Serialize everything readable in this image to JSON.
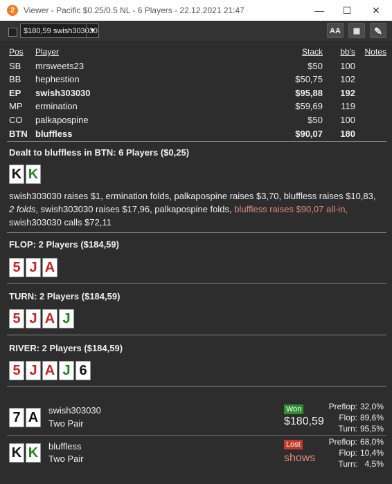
{
  "window": {
    "title": "Viewer - Pacific $0.25/0.5 NL - 6 Players - 22.12.2021 21:47",
    "icon": "2",
    "minimize": "—",
    "maximize": "☐",
    "close": "✕"
  },
  "toolbar": {
    "hand_select": "$180,59 swish303030",
    "arrow": "▼",
    "font_btn": "AA",
    "grid_btn": "▦",
    "edit_btn": "✎"
  },
  "table": {
    "headers": {
      "pos": "Pos",
      "player": "Player",
      "stack": "Stack",
      "bbs": "bb's",
      "notes": "Notes"
    },
    "rows": [
      {
        "pos": "SB",
        "player": "mrsweets23",
        "stack": "$50",
        "bbs": "100"
      },
      {
        "pos": "BB",
        "player": "hephestion",
        "stack": "$50,75",
        "bbs": "102"
      },
      {
        "pos": "EP",
        "player": "swish303030",
        "stack": "$95,88",
        "bbs": "192"
      },
      {
        "pos": "MP",
        "player": "ermination",
        "stack": "$59,69",
        "bbs": "119"
      },
      {
        "pos": "CO",
        "player": "palkapospine",
        "stack": "$50",
        "bbs": "100"
      },
      {
        "pos": "BTN",
        "player": "bluffless",
        "stack": "$90,07",
        "bbs": "180"
      }
    ]
  },
  "preflop": {
    "title": "Dealt to bluffless in BTN: 6 Players ($0,25)",
    "cards": [
      {
        "rank": "K",
        "color": "#111111"
      },
      {
        "rank": "K",
        "color": "#1a8a1a"
      }
    ],
    "actions": {
      "a1": "swish303030 raises $1, ermination folds, palkapospine raises $3,70, bluffless raises $10,83,",
      "a2": "2 folds",
      "a3": ", swish303030 raises $17,96, palkapospine folds, ",
      "a4": "bluffless raises $90,07 all-in,",
      "a5": "swish303030 calls $72,11"
    }
  },
  "flop": {
    "title": "FLOP: 2 Players ($184,59)",
    "cards": [
      {
        "rank": "5",
        "color": "#cc2222"
      },
      {
        "rank": "J",
        "color": "#cc2222"
      },
      {
        "rank": "A",
        "color": "#cc2222"
      }
    ]
  },
  "turn": {
    "title": "TURN: 2 Players ($184,59)",
    "cards": [
      {
        "rank": "5",
        "color": "#cc2222"
      },
      {
        "rank": "J",
        "color": "#cc2222"
      },
      {
        "rank": "A",
        "color": "#cc2222"
      },
      {
        "rank": "J",
        "color": "#1a8a1a"
      }
    ]
  },
  "river": {
    "title": "RIVER: 2 Players ($184,59)",
    "cards": [
      {
        "rank": "5",
        "color": "#cc2222"
      },
      {
        "rank": "J",
        "color": "#cc2222"
      },
      {
        "rank": "A",
        "color": "#cc2222"
      },
      {
        "rank": "J",
        "color": "#1a8a1a"
      },
      {
        "rank": "6",
        "color": "#111111"
      }
    ]
  },
  "results": [
    {
      "player": "swish303030",
      "hand": "Two Pair",
      "cards": [
        {
          "rank": "7",
          "color": "#111111"
        },
        {
          "rank": "A",
          "color": "#111111"
        }
      ],
      "badge": "Won",
      "amount": "$180,59",
      "stats": [
        {
          "label": "Preflop:",
          "value": "32,0%"
        },
        {
          "label": "Flop:",
          "value": "89,6%"
        },
        {
          "label": "Turn:",
          "value": "95,5%"
        }
      ]
    },
    {
      "player": "bluffless",
      "hand": "Two Pair",
      "cards": [
        {
          "rank": "K",
          "color": "#111111"
        },
        {
          "rank": "K",
          "color": "#1a8a1a"
        }
      ],
      "badge": "Lost",
      "amount": "shows",
      "stats": [
        {
          "label": "Preflop:",
          "value": "68,0%"
        },
        {
          "label": "Flop:",
          "value": "10,4%"
        },
        {
          "label": "Turn:",
          "value": "4,5%"
        }
      ]
    }
  ]
}
